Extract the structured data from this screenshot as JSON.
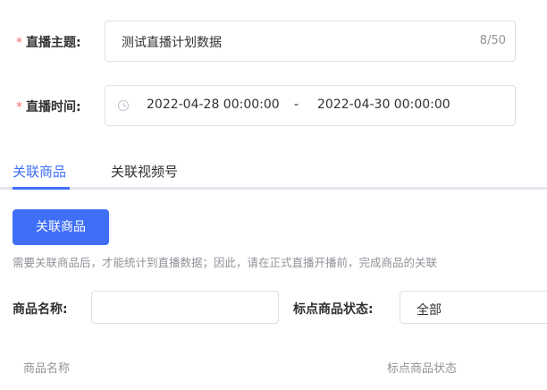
{
  "form": {
    "required_mark": "*",
    "theme_label": "直播主题:",
    "theme_value": "测试直播计划数据",
    "theme_counter": "8/50",
    "time_label": "直播时间:",
    "time_start": "2022-04-28 00:00:00",
    "time_separator": "-",
    "time_end": "2022-04-30 00:00:00"
  },
  "tabs": [
    {
      "label": "关联商品",
      "active": true
    },
    {
      "label": "关联视频号",
      "active": false
    }
  ],
  "actions": {
    "link_products_button": "关联商品",
    "hint": "需要关联商品后，才能统计到直播数据；因此，请在正式直播开播前，完成商品的关联"
  },
  "filters": {
    "product_name_label": "商品名称:",
    "product_name_value": "",
    "status_label": "标点商品状态:",
    "status_value": "全部"
  },
  "table": {
    "columns": [
      "商品名称",
      "标点商品状态"
    ]
  },
  "colors": {
    "accent": "#3f6ef7",
    "required": "#f56c6c"
  },
  "icons": {
    "time": "clock-icon"
  }
}
